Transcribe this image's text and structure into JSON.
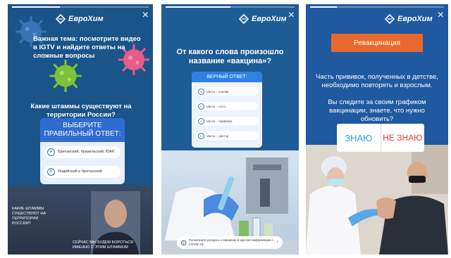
{
  "brand": {
    "name": "ЕвроХим",
    "primary_blue": "#1a5488",
    "accent_orange": "#e8692d",
    "answer_blue": "#2f6cd0"
  },
  "close_glyph": "×",
  "story1": {
    "progress": 0.35,
    "topic": "Важная тема: посмотрите видео в IGTV и найдите ответы на сложные вопросы",
    "question": "Какие штаммы существуют на территории России?",
    "card_title": "ВЫБЕРИТЕ ПРАВИЛЬНЫЙ ОТВЕТ:",
    "options": [
      {
        "letter": "A",
        "text": "Британский, бразильский, ЮАР,"
      },
      {
        "letter": "B",
        "text": "Индийский и британский"
      }
    ],
    "video_caption_left": "КАКИЕ ШТАММЫ СУЩЕСТВУЮТ НА ТЕРРИТОРИИ РОССИИ?",
    "video_caption_bottom": "СЕЙЧАС МЫ БУДЕМ БОРОТЬСЯ ИМЕННО С ЭТИМ ШТАММОМ"
  },
  "story2": {
    "progress": 0.5,
    "question": "От какого слова произошло название «вакцина»?",
    "card_title": "ВЕРНЫЙ ОТВЕТ:",
    "options": [
      {
        "letter": "A",
        "text": "Vacca – корова"
      },
      {
        "letter": "B",
        "text": "Vacca – гость"
      },
      {
        "letter": "C",
        "text": "Vacca – прививка"
      },
      {
        "letter": "D",
        "text": "Vacca – доктор"
      }
    ],
    "info_text": "Посмотрите ресурсы о вакцинах в Центре информации о COVID-19."
  },
  "story3": {
    "progress": 0.2,
    "pill": "Ревакцинация",
    "text1": "Часть прививок, полученных в детстве, необходимо повторять и взрослым.",
    "text2": "Вы следите за своим графиком вакцинации, знаете, что нужно обновить?",
    "poll_yes": "ЗНАЮ",
    "poll_no": "НЕ ЗНАЮ"
  }
}
